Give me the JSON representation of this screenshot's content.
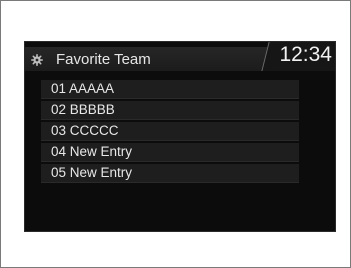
{
  "header": {
    "title": "Favorite Team",
    "icon": "gear-icon",
    "clock": "12:34"
  },
  "list": {
    "items": [
      {
        "label": "01 AAAAA"
      },
      {
        "label": "02 BBBBB"
      },
      {
        "label": "03 CCCCC"
      },
      {
        "label": "04 New Entry"
      },
      {
        "label": "05 New Entry"
      }
    ]
  },
  "colors": {
    "screen_background": "#0c0c0c",
    "text": "#e8e8e8",
    "row_background": "#1e1e1e"
  }
}
